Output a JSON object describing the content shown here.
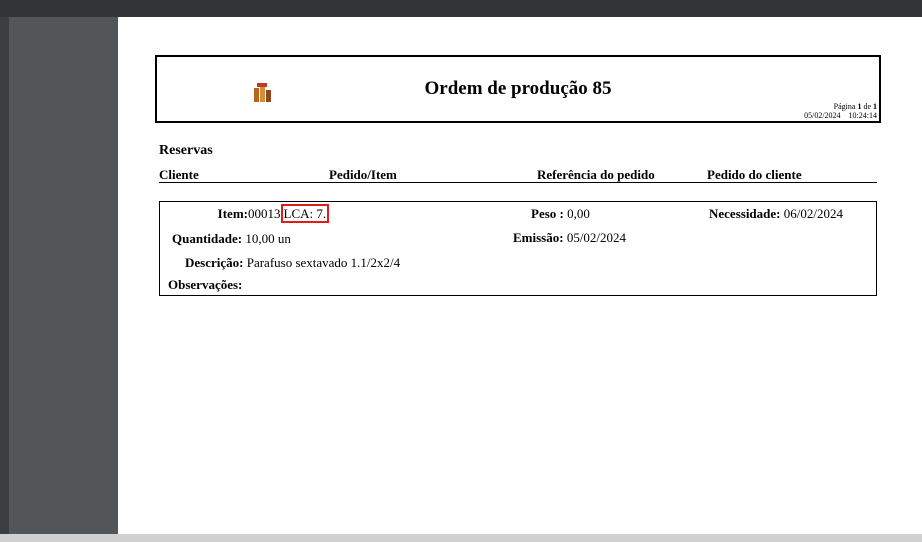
{
  "document": {
    "title": "Ordem de produção 85",
    "page_info": {
      "page_label": "Página",
      "page_number": "1",
      "of_label": "de",
      "page_total": "1",
      "date": "05/02/2024",
      "time": "10:24:14"
    }
  },
  "section": {
    "title": "Reservas",
    "columns": [
      "Cliente",
      "Pedido/Item",
      "Referência do pedido",
      "Pedido do cliente"
    ]
  },
  "detail": {
    "item_label": "Item:",
    "item_code": "00013",
    "item_lca": "LCA: 7.",
    "peso_label": "Peso :",
    "peso_value": "0,00",
    "necessidade_label": "Necessidade:",
    "necessidade_value": "06/02/2024",
    "quantidade_label": "Quantidade:",
    "quantidade_value": "10,00 un",
    "emissao_label": "Emissão:",
    "emissao_value": "05/02/2024",
    "descricao_label": "Descrição:",
    "descricao_value": "Parafuso sextavado 1.1/2x2/4",
    "observacoes_label": "Observações:"
  },
  "colors": {
    "highlight": "#e01b1b",
    "viewer_background": "#525659",
    "page": "#ffffff"
  }
}
